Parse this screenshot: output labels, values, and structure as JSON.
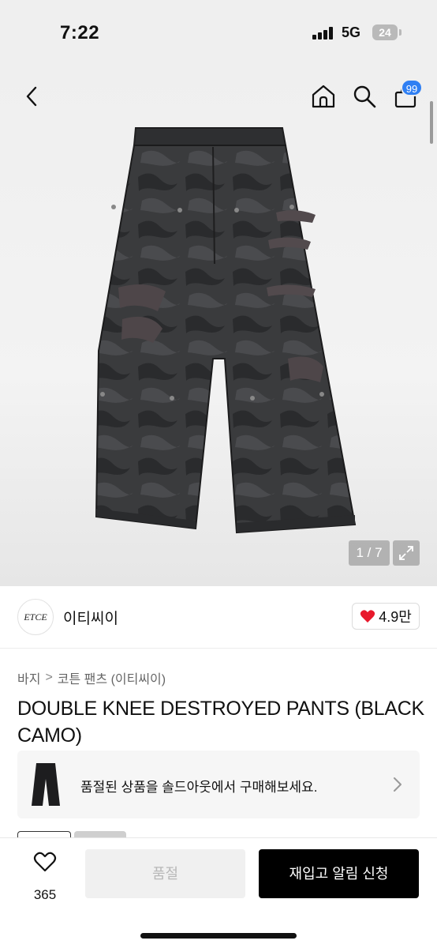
{
  "status_bar": {
    "time": "7:22",
    "network": "5G",
    "battery": "24"
  },
  "header": {
    "cart_badge": "99",
    "icons": [
      "back-chevron-icon",
      "home-icon",
      "search-icon",
      "shopping-bag-icon"
    ]
  },
  "gallery": {
    "counter": "1 / 7"
  },
  "brand": {
    "logo_text": "ETCE",
    "name": "이티씨이",
    "likes": "4.9만"
  },
  "breadcrumb": {
    "category": "바지",
    "separator": ">",
    "subcategory": "코튼 팬츠 (이티씨이)"
  },
  "product": {
    "title": "DOUBLE KNEE DESTROYED PANTS (BLACK CAMO)"
  },
  "soldout_banner": {
    "text": "품절된 상품을 솔드아웃에서 구매해보세요."
  },
  "bottom_bar": {
    "wish_count": "365",
    "soldout_label": "품절",
    "restock_label": "재입고 알림 신청"
  },
  "colors": {
    "accent_badge": "#2f7ff3",
    "heart": "#e8192c",
    "primary_button": "#000000",
    "disabled_button": "#f0f0f0"
  }
}
